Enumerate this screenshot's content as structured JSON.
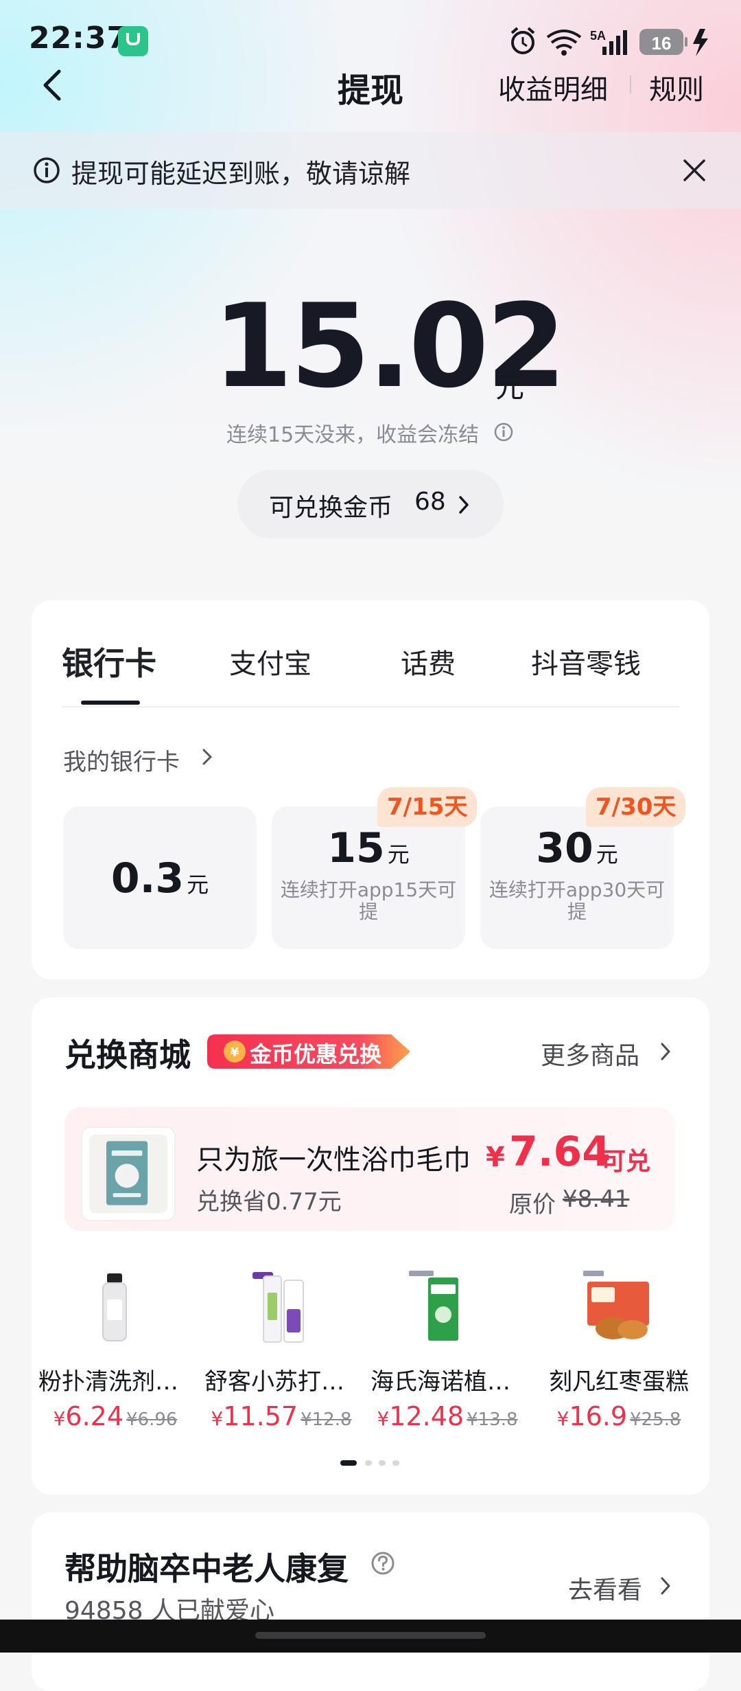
{
  "status_bar": {
    "time": "22:37",
    "network": "5A",
    "battery": "16"
  },
  "nav": {
    "title": "提现",
    "earnings_detail": "收益明细",
    "rules": "规则"
  },
  "notice": {
    "text": "提现可能延迟到账，敬请谅解"
  },
  "balance": {
    "amount": "15.02",
    "unit": "元",
    "freeze_note": "连续15天没来，收益会冻结",
    "coin_label": "可兑换金币",
    "coin_value": "68"
  },
  "withdraw": {
    "tabs": [
      {
        "label": "银行卡",
        "active": true
      },
      {
        "label": "支付宝",
        "active": false
      },
      {
        "label": "话费",
        "active": false
      },
      {
        "label": "抖音零钱",
        "active": false
      }
    ],
    "my_card_link": "我的银行卡",
    "options": [
      {
        "amount": "0.3",
        "unit": "元",
        "subtitle": "",
        "badge": ""
      },
      {
        "amount": "15",
        "unit": "元",
        "subtitle": "连续打开app15天可提",
        "badge": "7/15天"
      },
      {
        "amount": "30",
        "unit": "元",
        "subtitle": "连续打开app30天可提",
        "badge": "7/30天"
      }
    ]
  },
  "shop": {
    "title": "兑换商城",
    "badge_text": "金币优惠兑换",
    "badge_coin_symbol": "¥",
    "more_link": "更多商品",
    "featured": {
      "name": "只为旅一次性浴巾毛巾",
      "saving": "兑换省0.77元",
      "currency": "¥",
      "price": "7.64",
      "redeem_label": "可兑",
      "original_label": "原价",
      "original_price": "¥8.41"
    },
    "products": [
      {
        "name": "粉扑清洗剂清洁液",
        "currency": "¥",
        "price": "6.24",
        "original": "¥6.96",
        "image": "cleanser-bottle"
      },
      {
        "name": "舒客小苏打牙膏",
        "currency": "¥",
        "price": "11.57",
        "original": "¥12.8",
        "image": "toothpaste"
      },
      {
        "name": "海氏海诺植物抑菌",
        "currency": "¥",
        "price": "12.48",
        "original": "¥13.8",
        "image": "green-box"
      },
      {
        "name": "刻凡红枣蛋糕",
        "currency": "¥",
        "price": "16.9",
        "original": "¥25.8",
        "image": "cake-box"
      }
    ],
    "page_dots": 4,
    "active_dot": 0
  },
  "charity": {
    "title": "帮助脑卒中老人康复",
    "count": "94858",
    "count_suffix": "人已献爱心",
    "go_link": "去看看"
  },
  "colors": {
    "accent_red": "#f0304a",
    "badge_orange": "#f0541f",
    "text_dark": "#16181f"
  }
}
